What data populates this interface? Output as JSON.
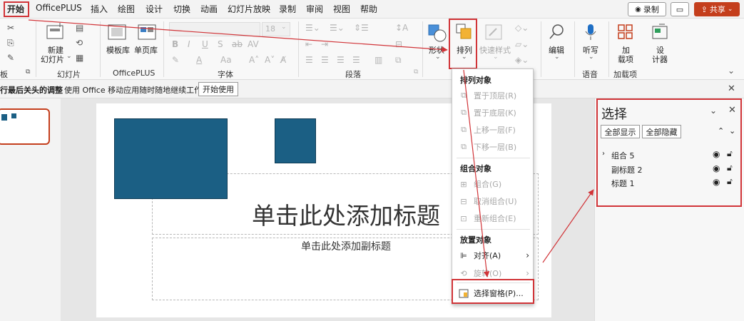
{
  "menu": {
    "tabs": [
      "开始",
      "OfficePLUS",
      "插入",
      "绘图",
      "设计",
      "切换",
      "动画",
      "幻灯片放映",
      "录制",
      "审阅",
      "视图",
      "帮助"
    ],
    "record_label": "录制",
    "share_label": "共享"
  },
  "ribbon": {
    "groups": [
      "板",
      "幻灯片",
      "OfficePLUS",
      "字体",
      "段落",
      "语音",
      "加载项"
    ],
    "new_slide": "新建",
    "new_slide2": "幻灯片",
    "template_lib": "模板库",
    "single_page_lib": "单页库",
    "font_size": "18",
    "shapes_label": "形状",
    "arrange_label": "排列",
    "quick_styles_label": "快速样式",
    "edit_label": "编辑",
    "dictate_label": "听写",
    "addins_label": "加",
    "addins_label2": "载项",
    "designer_label": "设",
    "designer_label2": "计器"
  },
  "infobar": {
    "message_bold": "行最后关头的调整",
    "message": "使用 Office 移动应用随时随地继续工作",
    "button": "开始使用"
  },
  "slide": {
    "title_placeholder": "单击此处添加标题",
    "subtitle_placeholder": "单击此处添加副标题",
    "shape_color": "#1b5f84"
  },
  "arrange_menu": {
    "section1": "排列对象",
    "bring_to_front": "置于顶层(R)",
    "send_to_back": "置于底层(K)",
    "bring_forward": "上移一层(F)",
    "send_backward": "下移一层(B)",
    "section2": "组合对象",
    "group": "组合(G)",
    "ungroup": "取消组合(U)",
    "regroup": "重新组合(E)",
    "section3": "放置对象",
    "align": "对齐(A)",
    "rotate": "旋转(O)",
    "selection_pane": "选择窗格(P)..."
  },
  "selection_pane": {
    "title": "选择",
    "show_all": "全部显示",
    "hide_all": "全部隐藏",
    "items": [
      "组合 5",
      "副标题 2",
      "标题 1"
    ]
  },
  "colors": {
    "annotation_red": "#d13438",
    "accent": "#c43e1c"
  }
}
